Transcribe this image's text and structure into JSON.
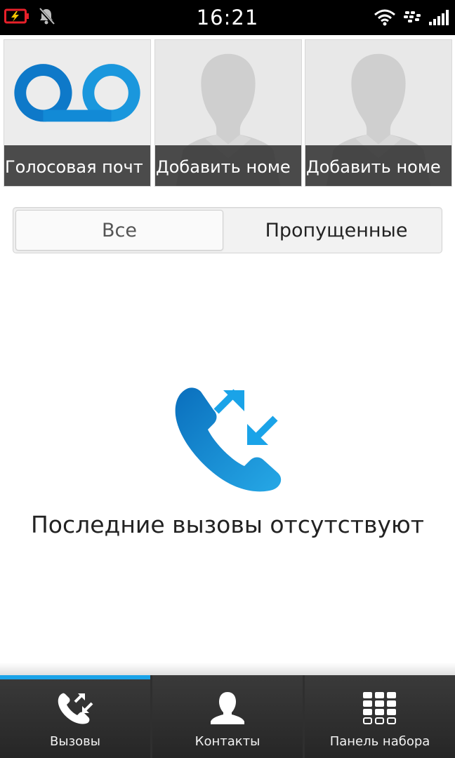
{
  "status_bar": {
    "time": "16:21",
    "icons": [
      "battery-charging-icon",
      "notifications-muted-icon",
      "wifi-icon",
      "blackberry-icon",
      "signal-icon"
    ]
  },
  "speed_dial": [
    {
      "label": "Голосовая почт",
      "icon": "voicemail-icon"
    },
    {
      "label": "Добавить номе",
      "icon": "contact-placeholder-icon"
    },
    {
      "label": "Добавить номе",
      "icon": "contact-placeholder-icon"
    }
  ],
  "filter": {
    "all_label": "Все",
    "missed_label": "Пропущенные",
    "selected": "all"
  },
  "empty_state": {
    "icon": "call-log-icon",
    "message": "Последние вызовы отсутствуют"
  },
  "bottom_nav": [
    {
      "label": "Вызовы",
      "icon": "calls-icon",
      "active": true
    },
    {
      "label": "Контакты",
      "icon": "contacts-icon",
      "active": false
    },
    {
      "label": "Панель набора",
      "icon": "dialpad-icon",
      "active": false
    }
  ],
  "colors": {
    "accent": "#1aa3e8",
    "blue_dark": "#0a6fbd",
    "battery_red": "#e8202a"
  }
}
